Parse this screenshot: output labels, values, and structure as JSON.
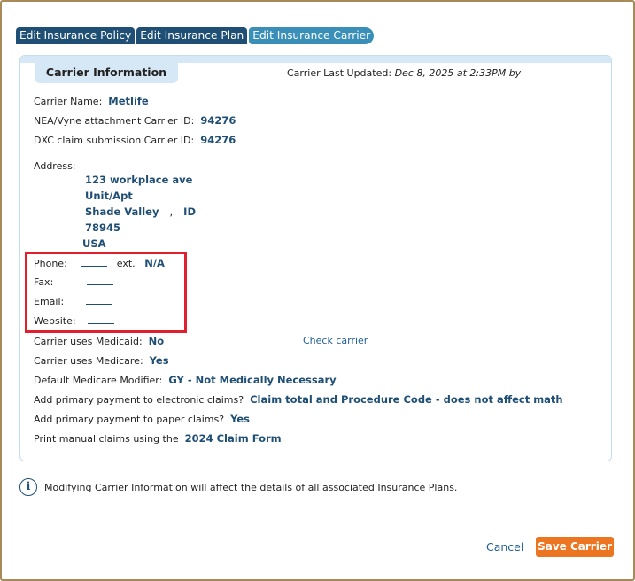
{
  "tabs": [
    {
      "label": "Edit Insurance Policy"
    },
    {
      "label": "Edit Insurance Plan"
    },
    {
      "label": "Edit Insurance Carrier"
    }
  ],
  "panel": {
    "title": "Carrier Information",
    "updated_label": "Carrier Last Updated:",
    "updated_value": "Dec 8, 2025 at 2:33PM by"
  },
  "carrier": {
    "name_label": "Carrier Name:",
    "name": "Metlife",
    "nea_label": "NEA/Vyne attachment Carrier ID:",
    "nea_id": "94276",
    "dxc_label": "DXC claim submission Carrier ID:",
    "dxc_id": "94276"
  },
  "address": {
    "label": "Address:",
    "line1": "123 workplace ave",
    "line2": "Unit/Apt",
    "city": "Shade Valley",
    "comma": ",",
    "state": "ID",
    "zip": "78945",
    "country": "USA"
  },
  "contact": {
    "phone_label": "Phone:",
    "ext_label": "ext.",
    "ext_value": "N/A",
    "fax_label": "Fax:",
    "email_label": "Email:",
    "website_label": "Website:"
  },
  "settings": {
    "medicaid_label": "Carrier uses Medicaid:",
    "medicaid_value": "No",
    "check_carrier": "Check carrier",
    "medicare_label": "Carrier uses Medicare:",
    "medicare_value": "Yes",
    "modifier_label": "Default Medicare Modifier:",
    "modifier_value": "GY - Not Medically Necessary",
    "electronic_label": "Add primary payment to electronic claims?",
    "electronic_value": "Claim total and Procedure Code - does not affect math",
    "paper_label": "Add primary payment to paper claims?",
    "paper_value": "Yes",
    "print_label": "Print manual claims using the",
    "print_value": "2024 Claim Form"
  },
  "info": {
    "icon": "i",
    "text": "Modifying Carrier Information will affect the details of all associated Insurance Plans."
  },
  "footer": {
    "cancel": "Cancel",
    "save": "Save Carrier"
  },
  "colors": {
    "accent": "#1f4f74",
    "active_tab": "#3a8fb9",
    "save_button": "#ec7522",
    "highlight": "#e0202e"
  }
}
